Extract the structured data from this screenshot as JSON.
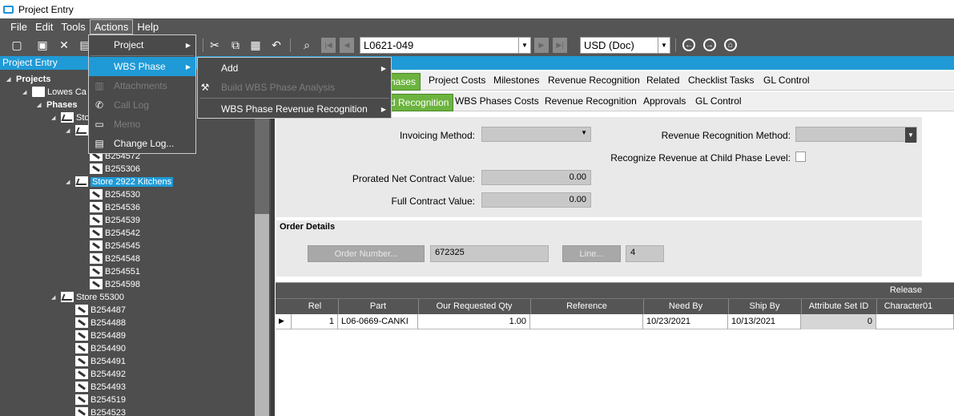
{
  "window": {
    "title": "Project Entry"
  },
  "menubar": {
    "items": [
      "File",
      "Edit",
      "Tools",
      "Actions",
      "Help"
    ]
  },
  "toolbar": {
    "record": "L0621-049",
    "currency": "USD (Doc)"
  },
  "panel_title": "Project Entry",
  "tree": {
    "projects": "Projects",
    "project": "Lowes Ca",
    "phases": "Phases",
    "store1": "Sto",
    "group1_items": [
      "B254572",
      "B255306"
    ],
    "store2": "Store 2922 Kitchens",
    "group2_items": [
      "B254530",
      "B254536",
      "B254539",
      "B254542",
      "B254545",
      "B254548",
      "B254551",
      "B254598"
    ],
    "store3": "Store 55300",
    "group3_items": [
      "B254487",
      "B254488",
      "B254489",
      "B254490",
      "B254491",
      "B254492",
      "B254493",
      "B254519",
      "B254523"
    ]
  },
  "tabs_top": [
    "hases",
    "Project Costs",
    "Milestones",
    "Revenue Recognition",
    "Related",
    "Checklist Tasks",
    "GL Control"
  ],
  "tabs_sub": [
    "d Recognition",
    "WBS Phases Costs",
    "Revenue Recognition",
    "Approvals",
    "GL Control"
  ],
  "form": {
    "invoicing_method_label": "Invoicing Method:",
    "invoicing_method_value": "",
    "rev_rec_method_label": "Revenue Recognition Method:",
    "rev_rec_method_value": "",
    "recognize_child_label": "Recognize Revenue at Child Phase Level:",
    "prorated_label": "Prorated Net Contract Value:",
    "prorated_value": "0.00",
    "full_label": "Full Contract Value:",
    "full_value": "0.00"
  },
  "order": {
    "title": "Order Details",
    "order_number_btn": "Order Number...",
    "order_number_value": "672325",
    "line_btn": "Line...",
    "line_value": "4"
  },
  "grid": {
    "group_header": "Release",
    "columns": [
      "Rel",
      "Part",
      "Our Requested Qty",
      "Reference",
      "Need By",
      "Ship By",
      "Attribute Set ID",
      "Character01"
    ],
    "rows": [
      {
        "rel": "1",
        "part": "L06-0669-CANKI",
        "qty": "1.00",
        "reference": "",
        "need_by": "10/23/2021",
        "ship_by": "10/13/2021",
        "attr": "0",
        "char01": ""
      }
    ]
  },
  "actions_menu": {
    "items": [
      {
        "label": "Project",
        "icon": "none",
        "enabled": true,
        "submenu": true
      },
      {
        "label": "WBS Phase",
        "icon": "none",
        "enabled": true,
        "submenu": true,
        "highlighted": true
      },
      {
        "label": "Attachments",
        "icon": "attachment-icon",
        "enabled": false
      },
      {
        "label": "Call Log",
        "icon": "phone-icon",
        "enabled": false
      },
      {
        "label": "Memo",
        "icon": "memo-icon",
        "enabled": false
      },
      {
        "label": "Change Log...",
        "icon": "book-icon",
        "enabled": true
      }
    ]
  },
  "wbs_submenu": {
    "items": [
      {
        "label": "Add",
        "enabled": true,
        "submenu": true
      },
      {
        "label": "Build WBS Phase Analysis",
        "enabled": false,
        "icon": "build-icon"
      },
      {
        "label": "WBS Phase Revenue Recognition",
        "enabled": true,
        "submenu": true
      }
    ]
  },
  "colors": {
    "accent": "#1f9ad6",
    "tab_green": "#6cb33f",
    "dark_bg": "#555555"
  }
}
